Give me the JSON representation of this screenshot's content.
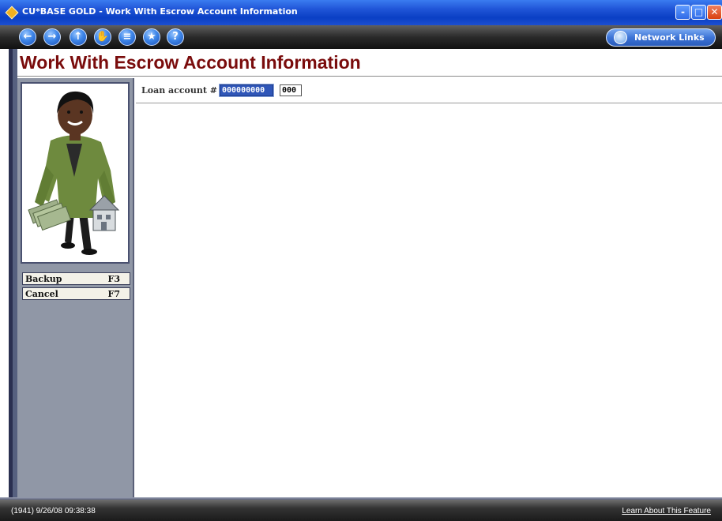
{
  "window": {
    "title": "CU*BASE GOLD - Work With Escrow Account Information",
    "controls": {
      "minimize": "-",
      "maximize": "□",
      "close": "✕"
    }
  },
  "toolbar": {
    "nav_buttons": [
      {
        "name": "back",
        "icon": "arrow-left-icon",
        "glyph": "←"
      },
      {
        "name": "forward",
        "icon": "arrow-right-icon",
        "glyph": "→"
      },
      {
        "name": "up",
        "icon": "arrow-up-icon",
        "glyph": "↑"
      },
      {
        "name": "stop",
        "icon": "hand-icon",
        "glyph": "✋"
      },
      {
        "name": "print",
        "icon": "printer-icon",
        "glyph": "≡"
      },
      {
        "name": "favorite",
        "icon": "star-icon",
        "glyph": "★"
      },
      {
        "name": "help",
        "icon": "help-icon",
        "glyph": "?"
      }
    ],
    "network_links": "Network Links"
  },
  "page": {
    "title": "Work With Escrow Account Information"
  },
  "sidebar": {
    "photo_icon": "woman-holding-money-and-house",
    "fkeys": [
      {
        "label": "Backup",
        "key": "F3"
      },
      {
        "label": "Cancel",
        "key": "F7"
      }
    ]
  },
  "form": {
    "loan_label": "Loan account #",
    "account_number": "000000000",
    "suffix": "000"
  },
  "status": {
    "stamp": "(1941) 9/26/08 09:38:38",
    "learn_link": "Learn About This Feature"
  },
  "colors": {
    "title_red": "#7a0c0c",
    "sidebar_gray": "#9097a6",
    "selected_field": "#2f56b8"
  }
}
